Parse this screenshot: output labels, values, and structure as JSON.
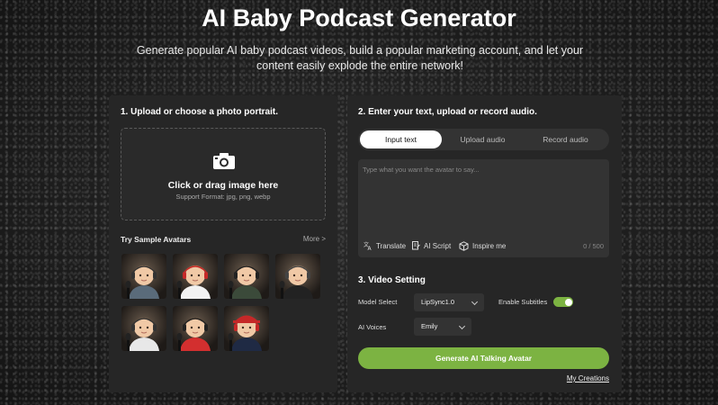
{
  "header": {
    "title": "AI Baby Podcast Generator",
    "subtitle": "Generate popular AI baby podcast videos, build a popular marketing account, and let your content easily explode the entire network!"
  },
  "upload_panel": {
    "heading": "1. Upload or choose a photo portrait.",
    "dropzone_label": "Click or drag image here",
    "dropzone_formats": "Support Format: jpg, png, webp",
    "icon": "camera-icon",
    "samples_label": "Try Sample Avatars",
    "more_label": "More >",
    "avatars": [
      {
        "shirt": "#5a6b7a",
        "hair": "#b8865a",
        "accent": "#333"
      },
      {
        "shirt": "#f2f2f2",
        "hair": "#c48a4a",
        "accent": "#c62828"
      },
      {
        "shirt": "#3b4a3a",
        "hair": "#8a6a4a",
        "accent": "#222"
      },
      {
        "shirt": "#222222",
        "hair": "#d0a070",
        "accent": "#444"
      },
      {
        "shirt": "#e8e8e8",
        "hair": "#7a5a3a",
        "accent": "#333"
      },
      {
        "shirt": "#d32f2f",
        "hair": "#6a4a2a",
        "accent": "#222"
      },
      {
        "shirt": "#1f2a44",
        "hair": "#c62828",
        "accent": "#c62828"
      }
    ]
  },
  "audio_panel": {
    "heading": "2. Enter your text, upload or record audio.",
    "tabs": [
      {
        "label": "Input text",
        "active": true
      },
      {
        "label": "Upload audio",
        "active": false
      },
      {
        "label": "Record audio",
        "active": false
      }
    ],
    "text_placeholder": "Type what you want the avatar to say...",
    "tools": {
      "translate": "Translate",
      "ai_script": "AI Script",
      "inspire": "Inspire me"
    },
    "char_count": "0 / 500"
  },
  "video_settings": {
    "heading": "3. Video Setting",
    "model_label": "Model Select",
    "model_value": "LipSync1.0",
    "subtitles_label": "Enable Subtitles",
    "subtitles_enabled": true,
    "voices_label": "AI Voices",
    "voice_value": "Emily"
  },
  "actions": {
    "generate_label": "Generate AI Talking Avatar",
    "my_creations_label": "My Creations"
  },
  "colors": {
    "accent": "#7cb342",
    "panel": "#262626",
    "field": "#333333"
  }
}
